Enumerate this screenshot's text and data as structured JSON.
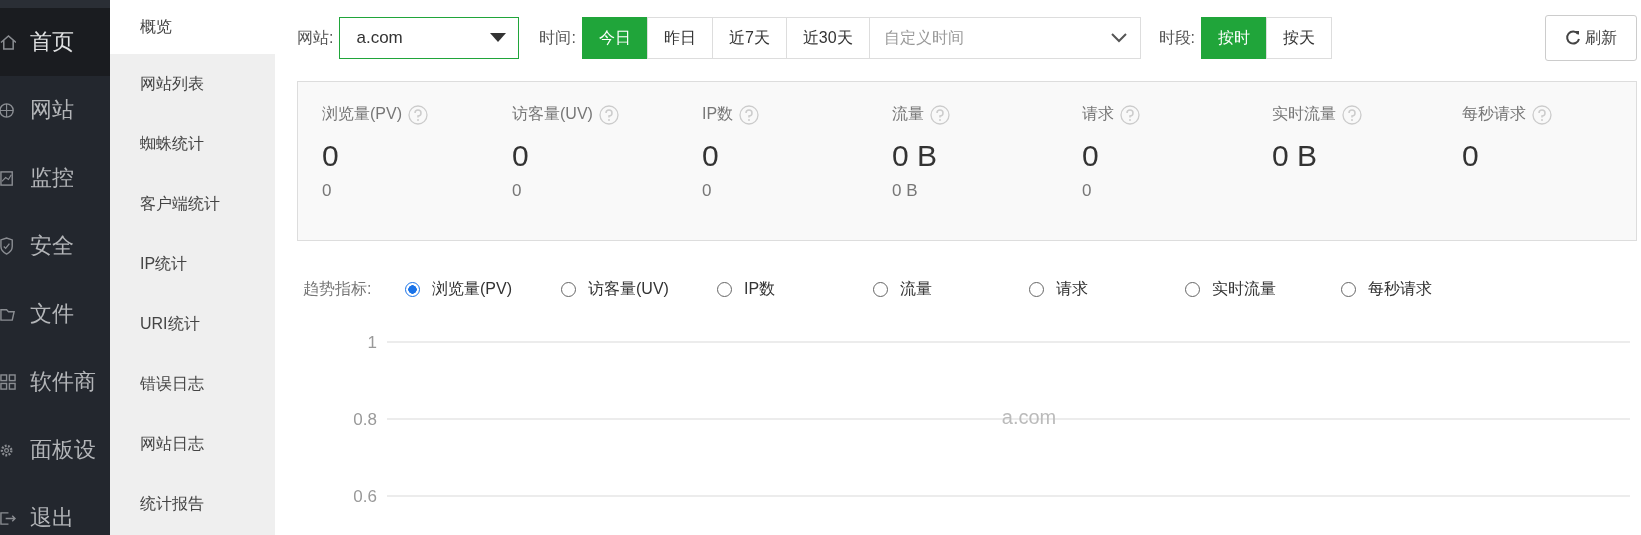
{
  "sidebar": {
    "items": [
      {
        "label": "首页",
        "selected": true
      },
      {
        "label": "网站",
        "selected": false
      },
      {
        "label": "监控",
        "selected": false
      },
      {
        "label": "安全",
        "selected": false
      },
      {
        "label": "文件",
        "selected": false
      },
      {
        "label": "软件商",
        "selected": false
      },
      {
        "label": "面板设",
        "selected": false
      },
      {
        "label": "退出",
        "selected": false
      }
    ]
  },
  "subnav": {
    "items": [
      {
        "label": "概览",
        "selected": true
      },
      {
        "label": "网站列表",
        "selected": false
      },
      {
        "label": "蜘蛛统计",
        "selected": false
      },
      {
        "label": "客户端统计",
        "selected": false
      },
      {
        "label": "IP统计",
        "selected": false
      },
      {
        "label": "URI统计",
        "selected": false
      },
      {
        "label": "错误日志",
        "selected": false
      },
      {
        "label": "网站日志",
        "selected": false
      },
      {
        "label": "统计报告",
        "selected": false
      }
    ]
  },
  "toolbar": {
    "site_label": "网站:",
    "site_value": "a.com",
    "time_label": "时间:",
    "time_options": [
      {
        "label": "今日",
        "selected": true
      },
      {
        "label": "昨日",
        "selected": false
      },
      {
        "label": "近7天",
        "selected": false
      },
      {
        "label": "近30天",
        "selected": false
      }
    ],
    "custom_time": {
      "placeholder": "自定义时间"
    },
    "period_label": "时段:",
    "period_options": [
      {
        "label": "按时",
        "selected": true
      },
      {
        "label": "按天",
        "selected": false
      }
    ],
    "refresh": "刷新"
  },
  "stats": [
    {
      "label": "浏览量(PV)",
      "value": "0",
      "sub": "0"
    },
    {
      "label": "访客量(UV)",
      "value": "0",
      "sub": "0"
    },
    {
      "label": "IP数",
      "value": "0",
      "sub": "0"
    },
    {
      "label": "流量",
      "value": "0 B",
      "sub": "0 B"
    },
    {
      "label": "请求",
      "value": "0",
      "sub": "0"
    },
    {
      "label": "实时流量",
      "value": "0 B"
    },
    {
      "label": "每秒请求",
      "value": "0"
    }
  ],
  "trend": {
    "label": "趋势指标:",
    "options": [
      {
        "label": "浏览量(PV)",
        "selected": true
      },
      {
        "label": "访客量(UV)",
        "selected": false
      },
      {
        "label": "IP数",
        "selected": false
      },
      {
        "label": "流量",
        "selected": false
      },
      {
        "label": "请求",
        "selected": false
      },
      {
        "label": "实时流量",
        "selected": false
      },
      {
        "label": "每秒请求",
        "selected": false
      }
    ]
  },
  "chart": {
    "title": "a.com",
    "y_labels": [
      "1",
      "0.8",
      "0.6"
    ]
  }
}
